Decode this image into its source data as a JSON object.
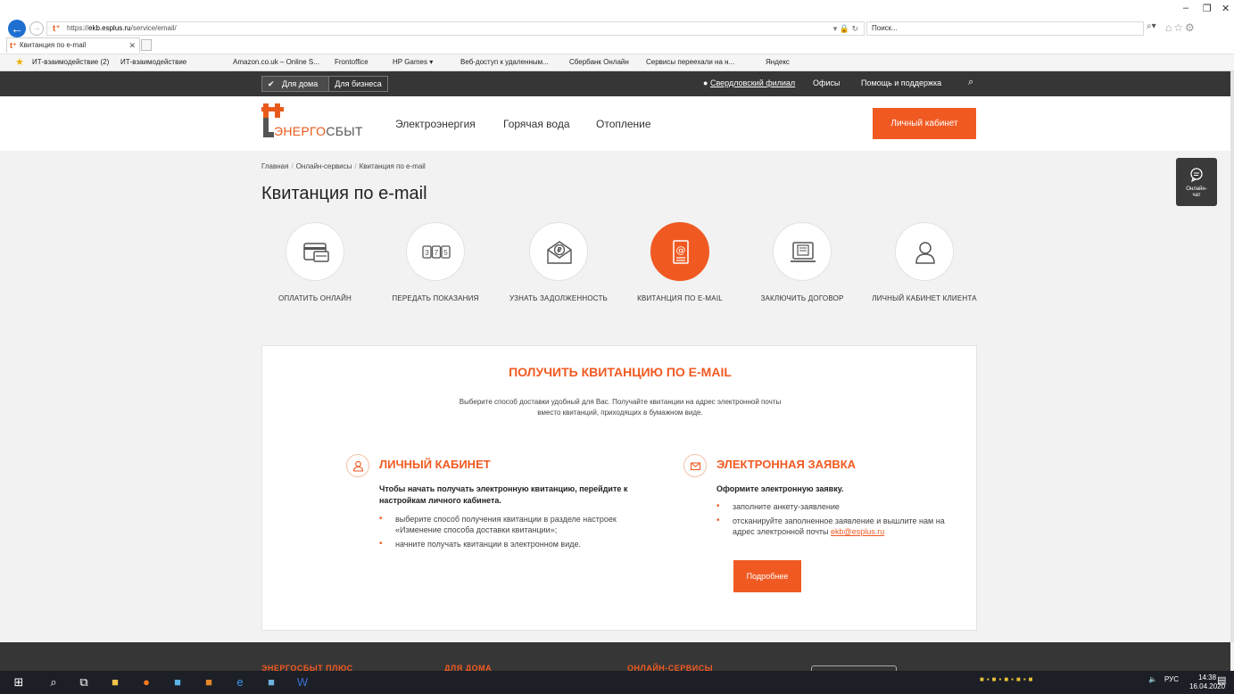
{
  "browser": {
    "url_prefix": "https://",
    "url_host": "ekb.esplus.ru",
    "url_path": "/service/email/",
    "address_tools": "▾ 🔒 ↻",
    "search_placeholder": "Поиск...",
    "tab_title": "Квитанция по e-mail",
    "favorites": [
      "ИТ-взаимодействие (2)",
      "ИТ-взаимодействие",
      "Amazon.co.uk – Online S...",
      "Frontoffice",
      "HP Games ▾",
      "Веб-доступ к удаленным...",
      "Сбербанк Онлайн",
      "Сервисы переехали на н...",
      "Яндекс"
    ]
  },
  "topbar": {
    "for_home": "Для дома",
    "for_business": "Для бизнеса",
    "region": "Свердловский филиал",
    "offices": "Офисы",
    "help": "Помощь и поддержка"
  },
  "header": {
    "logo_part1": "ЭНЕРГО",
    "logo_part2": "СБЫТ",
    "nav": [
      "Электроэнергия",
      "Горячая вода",
      "Отопление"
    ],
    "cabinet_button": "Личный кабинет"
  },
  "breadcrumbs": [
    "Главная",
    "Онлайн-сервисы",
    "Квитанция по e-mail"
  ],
  "page_title": "Квитанция по e-mail",
  "services": [
    {
      "label": "ОПЛАТИТЬ ОНЛАЙН",
      "icon": "card-icon"
    },
    {
      "label": "ПЕРЕДАТЬ ПОКАЗАНИЯ",
      "icon": "meter-icon"
    },
    {
      "label": "УЗНАТЬ ЗАДОЛЖЕННОСТЬ",
      "icon": "envelope-ruble-icon"
    },
    {
      "label": "КВИТАНЦИЯ ПО E-MAIL",
      "icon": "email-receipt-icon"
    },
    {
      "label": "ЗАКЛЮЧИТЬ ДОГОВОР",
      "icon": "contract-icon"
    },
    {
      "label": "ЛИЧНЫЙ КАБИНЕТ КЛИЕНТА",
      "icon": "user-icon"
    }
  ],
  "card": {
    "title": "ПОЛУЧИТЬ КВИТАНЦИЮ ПО E-MAIL",
    "subtitle": "Выберите способ доставки удобный для Вас. Получайте квитанции на адрес электронной почты вместо квитанций, приходящих в бумажном виде.",
    "left": {
      "title": "ЛИЧНЫЙ КАБИНЕТ",
      "lead": "Чтобы начать получать электронную квитанцию, перейдите к настройкам личного кабинета.",
      "bullets": [
        "выберите способ получения квитанции в разделе настроек «Изменение способа доставки квитанции»;",
        "начните получать квитанции в электронном виде."
      ]
    },
    "right": {
      "title": "ЭЛЕКТРОННАЯ ЗАЯВКА",
      "lead": "Оформите электронную заявку.",
      "bullet1": "заполните анкету-заявление",
      "bullet2": "отсканируйте заполненное заявление и вышлите нам на адрес электронной почты",
      "email": "ekb@esplus.ru",
      "button": "Подробнее"
    }
  },
  "chat": {
    "line1": "Онлайн-",
    "line2": "чат"
  },
  "footer": [
    "ЭНЕРГОСБЫТ ПЛЮС",
    "ДЛЯ ДОМА",
    "ОНЛАЙН-СЕРВИСЫ"
  ],
  "taskbar": {
    "lang": "РУС",
    "time": "14:38",
    "date": "16.04.2020"
  }
}
